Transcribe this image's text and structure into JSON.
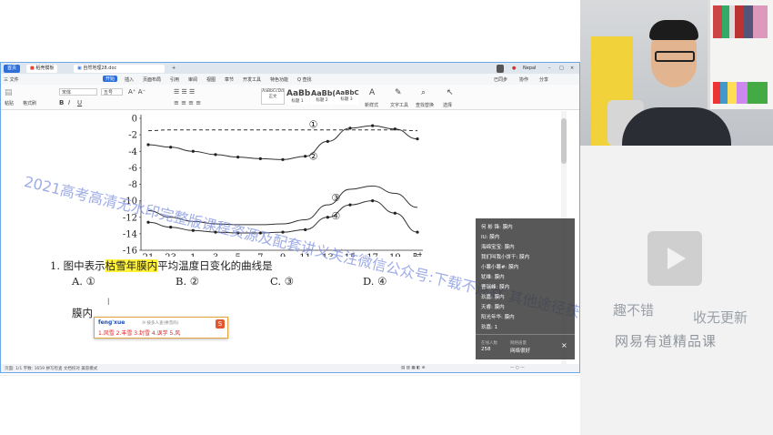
{
  "wps": {
    "tabs": [
      "首页",
      "稻壳模板",
      "自然地理28.doc"
    ],
    "add_tab": "+",
    "user": "Nepal",
    "menu": [
      "三 文件",
      "开始",
      "插入",
      "页面布局",
      "引用",
      "审阅",
      "视图",
      "章节",
      "开发工具",
      "特色功能",
      "Q 查找"
    ],
    "menu_right": [
      "已同步",
      "协作",
      "分享"
    ],
    "ribbon": {
      "paste": "粘贴",
      "format_painter": "格式刷",
      "font": "宋体",
      "size": "五号",
      "styles": [
        {
          "preview": "AaBbCcDd",
          "name": "正文"
        },
        {
          "preview": "AaBb",
          "name": "标题 1"
        },
        {
          "preview": "AaBb(",
          "name": "标题 2"
        },
        {
          "preview": "AaBbC",
          "name": "标题 3"
        }
      ],
      "text_layout": "新样式",
      "text_tools": "文字工具",
      "find_replace": "查找替换",
      "select": "选择"
    },
    "status": "页面: 1/1  字数: 1659  拼写检查  文档校对  兼容模式"
  },
  "chart_data": {
    "type": "line",
    "x": [
      "21",
      "23",
      "1",
      "3",
      "5",
      "7",
      "9",
      "11",
      "13",
      "15",
      "17",
      "19",
      "时"
    ],
    "yticks": [
      "0",
      "-2",
      "-4",
      "-6",
      "-8",
      "-10",
      "-12",
      "-14",
      "-16"
    ],
    "ylim": [
      -16,
      0
    ],
    "series": [
      {
        "name": "①",
        "values": [
          -1.5,
          -1.4,
          -1.4,
          -1.4,
          -1.4,
          -1.4,
          -1.4,
          -1.4,
          -1.4,
          -1.4,
          -1.4,
          -1.4,
          -1.5
        ]
      },
      {
        "name": "②",
        "values": [
          -3.2,
          -3.5,
          -4.0,
          -4.4,
          -4.7,
          -4.9,
          -5.0,
          -4.6,
          -2.8,
          -1.2,
          -0.9,
          -1.3,
          -2.5
        ]
      },
      {
        "name": "③",
        "values": [
          -11.2,
          -12.0,
          -12.5,
          -12.8,
          -12.9,
          -12.9,
          -12.8,
          -12.3,
          -10.5,
          -8.6,
          -8.2,
          -9.1,
          -10.8
        ]
      },
      {
        "name": "④",
        "values": [
          -12.6,
          -13.2,
          -13.6,
          -13.8,
          -13.9,
          -13.9,
          -13.8,
          -13.5,
          -12.0,
          -10.5,
          -10.0,
          -11.5,
          -13.8
        ]
      }
    ]
  },
  "question": {
    "number": "1.",
    "before": "图中表示",
    "highlight": "枯雪年膜内",
    "after": "平均温度日变化的曲线是",
    "options": [
      "A. ①",
      "B. ②",
      "C. ③",
      "D. ④"
    ],
    "typing": "膜内",
    "cursor": "|"
  },
  "ime": {
    "input": "feng'xue",
    "hint": "⑩ 按多人查(拼音码)",
    "candidates": "1.风雪  2.丰雪  3.封雪  4.讽学  5.风",
    "logo": "S"
  },
  "chat": {
    "messages": [
      "何 彬 锋: 膜内",
      "IU: 膜内",
      "海绵宝宝: 膜内",
      "我们叫我小饼干: 膜内",
      "小薯小薯#: 膜内",
      "犹维: 膜内",
      "曹瑞峰: 膜内",
      "玖嘉: 膜内",
      "天睿: 膜内",
      "阳光年华: 膜内",
      "玖嘉: 1"
    ],
    "online_label": "在线人数",
    "online_count": "258",
    "network_label": "网络质量",
    "network_value": "网络很好",
    "close": "×"
  },
  "watermark": {
    "line": "2021高考高清无水印完整版课程资源及配套讲义关注微信公众号:下载不迷路 其他途径获取无更新",
    "brand_left": "趣不错",
    "brand_right": "收无更新",
    "platform": "网易有道精品课"
  }
}
